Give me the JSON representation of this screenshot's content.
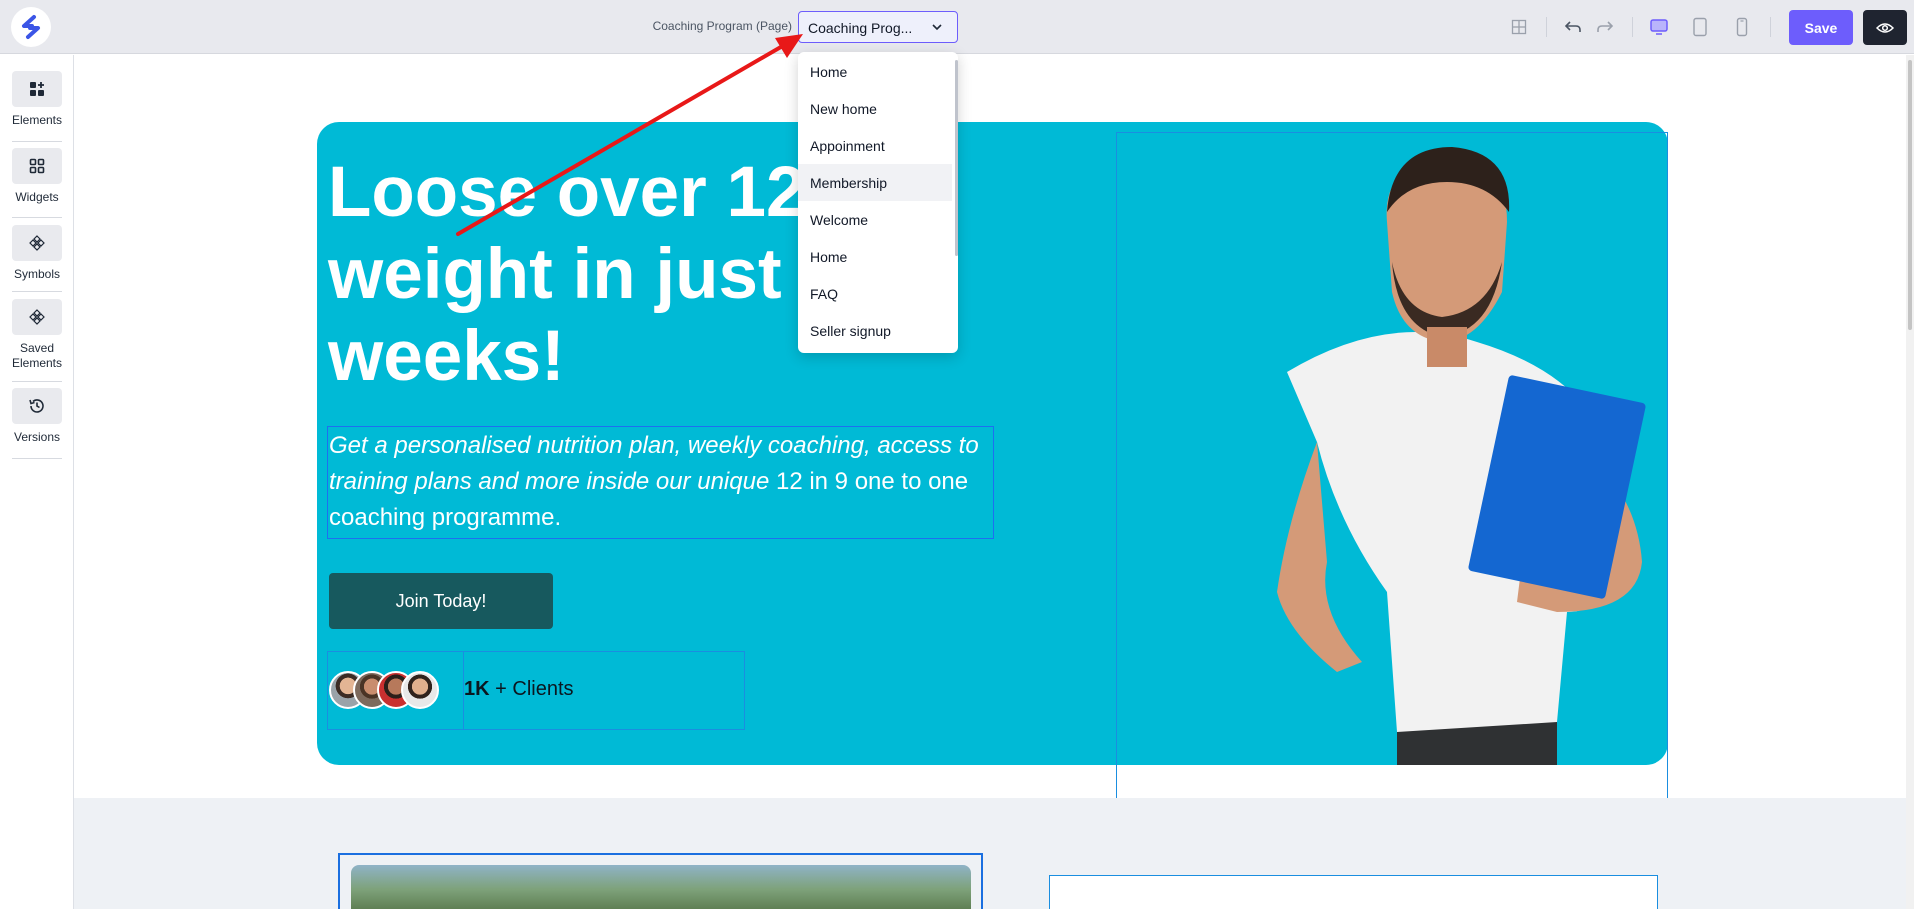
{
  "header": {
    "page_label": "Coaching Program (Page)",
    "page_select_value": "Coaching Prog...",
    "save_label": "Save"
  },
  "sidebar": {
    "items": [
      {
        "label": "Elements",
        "icon": "elements-add-icon"
      },
      {
        "label": "Widgets",
        "icon": "widgets-icon"
      },
      {
        "label": "Symbols",
        "icon": "symbols-icon"
      },
      {
        "label": "Saved Elements",
        "icon": "saved-elements-icon"
      },
      {
        "label": "Versions",
        "icon": "history-icon"
      }
    ]
  },
  "dropdown": {
    "options": [
      "Home",
      "New home",
      "Appoinment",
      "Membership",
      "Welcome",
      "Home",
      "FAQ",
      "Seller signup"
    ],
    "hovered": "Membership"
  },
  "hero": {
    "title_line1": "Loose over 12",
    "title_line2": "weight in just",
    "title_line3": "weeks!",
    "subtitle_italic": "Get a personalised nutrition plan, weekly coaching, access to training plans and more inside our unique",
    "subtitle_plain": " 12 in 9 one to one coaching programme.",
    "cta_label": "Join Today!",
    "clients_count": "1K",
    "clients_suffix": " + Clients"
  },
  "colors": {
    "accent": "#6d5dfc",
    "hero_bg": "#00bad6",
    "cta_bg": "#17595e",
    "selection_outline": "#1a8ee0",
    "annotation_arrow": "#e81818"
  }
}
